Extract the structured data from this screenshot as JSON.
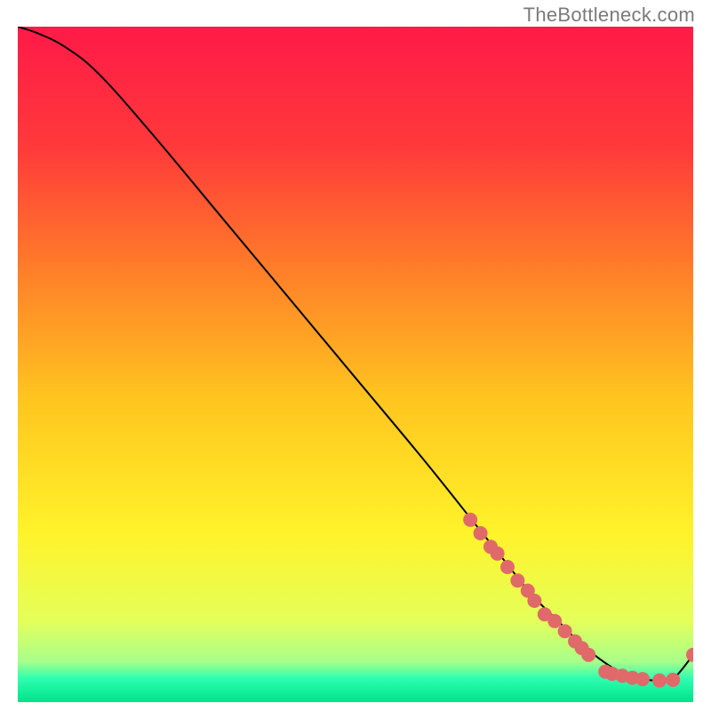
{
  "watermark": "TheBottleneck.com",
  "chart_data": {
    "type": "line",
    "title": "",
    "xlabel": "",
    "ylabel": "",
    "xlim": [
      0,
      100
    ],
    "ylim": [
      0,
      100
    ],
    "grid": false,
    "series": [
      {
        "name": "curve",
        "x": [
          0,
          3,
          7,
          12,
          20,
          30,
          40,
          50,
          60,
          68,
          72,
          76,
          80,
          83,
          86,
          89,
          91,
          93,
          95,
          97,
          100
        ],
        "values": [
          100,
          99,
          97,
          93,
          84,
          72,
          60,
          48,
          36,
          26,
          21,
          16,
          12,
          9,
          6.5,
          4.5,
          3.6,
          3.3,
          3.2,
          3.4,
          7
        ]
      },
      {
        "name": "markers",
        "x": [
          67,
          68.5,
          70,
          71,
          72.5,
          74,
          75.5,
          76.5,
          78,
          79.5,
          81,
          82.5,
          83.5,
          84.5,
          87,
          88,
          89.5,
          91,
          92.5,
          95,
          97,
          100
        ],
        "values": [
          27,
          25,
          23,
          22,
          20,
          18,
          16.5,
          15,
          13,
          12,
          10.5,
          9,
          8,
          7,
          4.5,
          4.2,
          3.9,
          3.6,
          3.4,
          3.2,
          3.3,
          7
        ]
      }
    ],
    "gradient_stops": [
      {
        "offset": 0.0,
        "color": "#ff1a48"
      },
      {
        "offset": 0.18,
        "color": "#ff3a3a"
      },
      {
        "offset": 0.35,
        "color": "#ff7a2a"
      },
      {
        "offset": 0.55,
        "color": "#ffc51f"
      },
      {
        "offset": 0.75,
        "color": "#fff32a"
      },
      {
        "offset": 0.88,
        "color": "#e4ff5a"
      },
      {
        "offset": 0.94,
        "color": "#a8ff8a"
      },
      {
        "offset": 0.965,
        "color": "#2dffb0"
      },
      {
        "offset": 1.0,
        "color": "#00e28a"
      }
    ],
    "curve_color": "#000000",
    "marker_color": "#e06a6a",
    "marker_radius": 8
  }
}
